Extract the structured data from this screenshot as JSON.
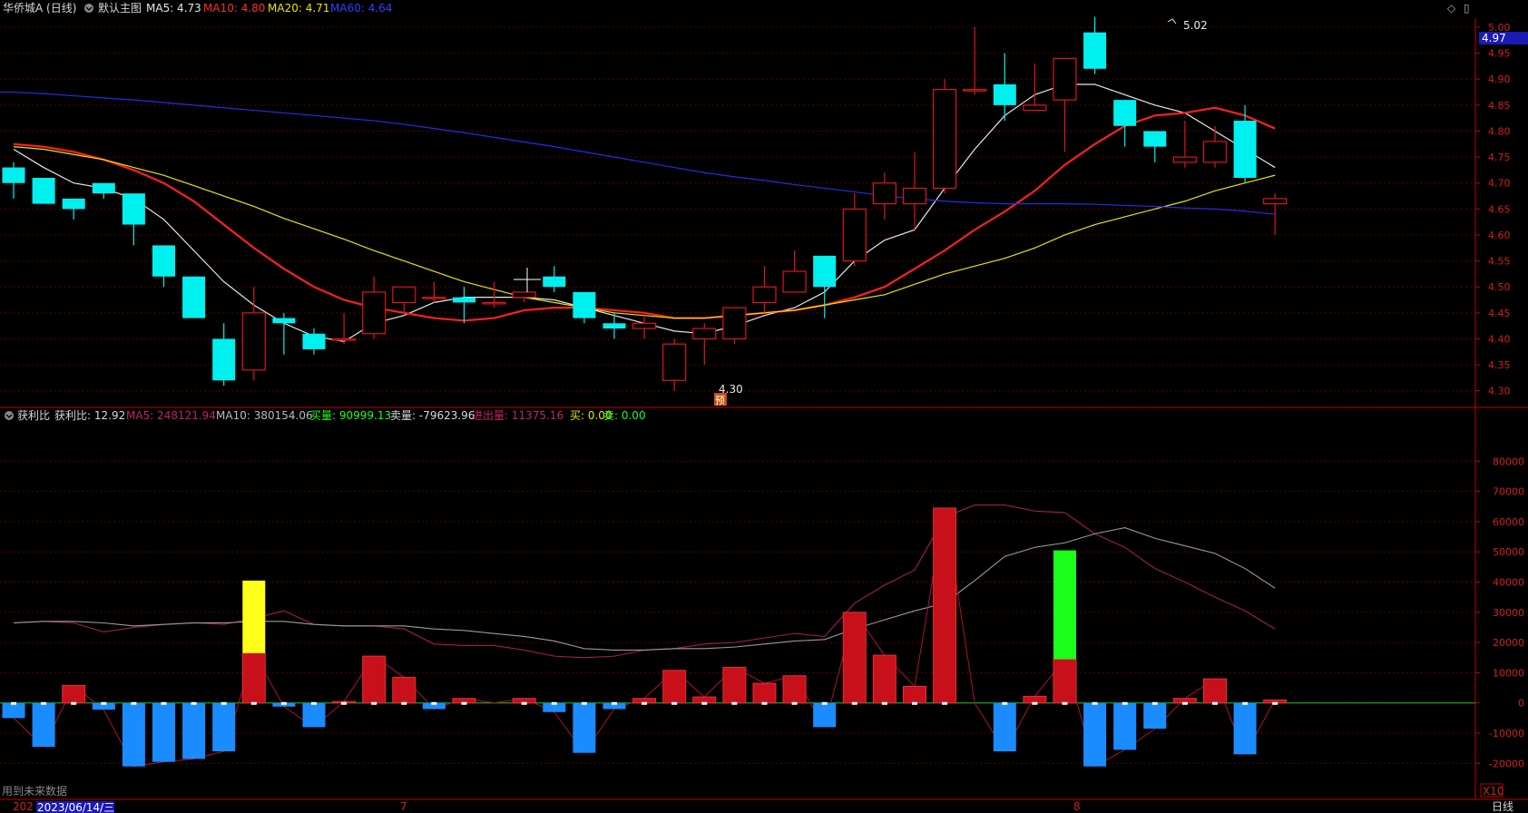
{
  "colors": {
    "up": "#e0151b",
    "down": "#00f0f0",
    "ma5": "#e8e8e8",
    "ma10": "#ff2020",
    "ma20": "#e6e600",
    "ma60": "#2a2ae8",
    "grid": "#5a0000",
    "axis": "#c00000",
    "tick": "#d02020",
    "bg": "#000000",
    "neg_bar": "#1a8cff",
    "zero": "#19c819",
    "yellow_bar": "#ffff1a",
    "green_bar": "#1aff1a"
  },
  "header": {
    "stock_name": "华侨城A (日线)",
    "template": "默认主图",
    "ma5": "MA5: 4.73",
    "ma10": "MA10: 4.80",
    "ma20": "MA20: 4.71",
    "ma60": "MA60: 4.64",
    "diamond_icon": "◇",
    "panel_icon": "▯"
  },
  "lower_header": {
    "name": "获利比",
    "ratio": "获利比: 12.92",
    "ma5": "MA5: 248121.94",
    "ma10": "MA10: 380154.06",
    "buy_vol": "买量: 90999.13",
    "sell_vol": "卖量: -79623.96",
    "in_out": "进出量: 11375.16",
    "buy": "买: 0.00",
    "sell": "卖: 0.00"
  },
  "footer": {
    "future_note": "用到未来数据",
    "year_stub": "202",
    "cursor_date": "2023/06/14/三",
    "month_7": "7",
    "month_8": "8",
    "scale": "X10",
    "period": "日线"
  },
  "chart_data": [
    {
      "type": "candlestick",
      "title": "华侨城A (日线)",
      "ylim": [
        4.27,
        5.02
      ],
      "y_ticks": [
        "5.00",
        "4.95",
        "4.90",
        "4.85",
        "4.80",
        "4.75",
        "4.70",
        "4.65",
        "4.60",
        "4.55",
        "4.50",
        "4.45",
        "4.40",
        "4.35",
        "4.30"
      ],
      "current_price": "4.97",
      "high_label": "5.02",
      "low_label": "4.30",
      "pre_label": "预",
      "candles": [
        [
          4.73,
          4.74,
          4.7,
          4.67
        ],
        [
          4.71,
          4.71,
          4.66,
          4.66
        ],
        [
          4.67,
          4.67,
          4.65,
          4.63
        ],
        [
          4.7,
          4.7,
          4.68,
          4.67
        ],
        [
          4.68,
          4.68,
          4.62,
          4.58
        ],
        [
          4.58,
          4.58,
          4.52,
          4.5
        ],
        [
          4.52,
          4.52,
          4.44,
          4.44
        ],
        [
          4.4,
          4.43,
          4.32,
          4.31
        ],
        [
          4.34,
          4.5,
          4.45,
          4.32
        ],
        [
          4.44,
          4.45,
          4.43,
          4.37
        ],
        [
          4.41,
          4.42,
          4.38,
          4.37
        ],
        [
          4.4,
          4.45,
          4.4,
          4.39
        ],
        [
          4.41,
          4.52,
          4.49,
          4.4
        ],
        [
          4.47,
          4.5,
          4.5,
          4.45
        ],
        [
          4.48,
          4.51,
          4.48,
          4.47
        ],
        [
          4.48,
          4.5,
          4.47,
          4.43
        ],
        [
          4.47,
          4.51,
          4.47,
          4.46
        ],
        [
          4.48,
          4.49,
          4.49,
          4.47
        ],
        [
          4.52,
          4.54,
          4.5,
          4.49
        ],
        [
          4.49,
          4.49,
          4.44,
          4.43
        ],
        [
          4.43,
          4.45,
          4.42,
          4.4
        ],
        [
          4.42,
          4.45,
          4.43,
          4.4
        ],
        [
          4.32,
          4.4,
          4.39,
          4.3
        ],
        [
          4.4,
          4.43,
          4.42,
          4.35
        ],
        [
          4.4,
          4.46,
          4.46,
          4.39
        ],
        [
          4.47,
          4.54,
          4.5,
          4.45
        ],
        [
          4.49,
          4.57,
          4.53,
          4.49
        ],
        [
          4.56,
          4.56,
          4.5,
          4.44
        ],
        [
          4.55,
          4.68,
          4.65,
          4.54
        ],
        [
          4.66,
          4.72,
          4.7,
          4.63
        ],
        [
          4.66,
          4.76,
          4.69,
          4.61
        ],
        [
          4.69,
          4.9,
          4.88,
          4.68
        ],
        [
          4.88,
          5.0,
          4.88,
          4.87
        ],
        [
          4.89,
          4.95,
          4.85,
          4.82
        ],
        [
          4.84,
          4.93,
          4.85,
          4.84
        ],
        [
          4.86,
          4.93,
          4.94,
          4.76
        ],
        [
          4.99,
          5.02,
          4.92,
          4.91
        ],
        [
          4.86,
          4.86,
          4.81,
          4.77
        ],
        [
          4.8,
          4.8,
          4.77,
          4.74
        ],
        [
          4.74,
          4.82,
          4.75,
          4.73
        ],
        [
          4.74,
          4.81,
          4.78,
          4.73
        ],
        [
          4.82,
          4.85,
          4.71,
          4.7
        ],
        [
          4.66,
          4.68,
          4.67,
          4.6
        ]
      ],
      "series": [
        {
          "name": "MA5",
          "values": [
            4.765,
            4.73,
            4.7,
            4.69,
            4.67,
            4.63,
            4.57,
            4.51,
            4.465,
            4.43,
            4.405,
            4.395,
            4.43,
            4.445,
            4.47,
            4.48,
            4.48,
            4.48,
            4.475,
            4.46,
            4.445,
            4.43,
            4.415,
            4.41,
            4.425,
            4.445,
            4.46,
            4.49,
            4.55,
            4.59,
            4.61,
            4.69,
            4.765,
            4.83,
            4.87,
            4.89,
            4.89,
            4.87,
            4.85,
            4.835,
            4.8,
            4.765,
            4.73
          ]
        },
        {
          "name": "MA10",
          "values": [
            4.775,
            4.77,
            4.76,
            4.745,
            4.725,
            4.7,
            4.665,
            4.62,
            4.575,
            4.535,
            4.5,
            4.475,
            4.46,
            4.45,
            4.44,
            4.435,
            4.44,
            4.455,
            4.46,
            4.46,
            4.455,
            4.45,
            4.44,
            4.44,
            4.445,
            4.45,
            4.455,
            4.465,
            4.48,
            4.5,
            4.535,
            4.57,
            4.61,
            4.645,
            4.685,
            4.735,
            4.775,
            4.81,
            4.83,
            4.835,
            4.845,
            4.83,
            4.805
          ]
        },
        {
          "name": "MA20",
          "values": [
            4.77,
            4.765,
            4.755,
            4.745,
            4.73,
            4.715,
            4.695,
            4.675,
            4.655,
            4.632,
            4.612,
            4.592,
            4.57,
            4.55,
            4.53,
            4.51,
            4.495,
            4.48,
            4.47,
            4.46,
            4.45,
            4.445,
            4.44,
            4.44,
            4.445,
            4.45,
            4.455,
            4.465,
            4.475,
            4.485,
            4.505,
            4.525,
            4.54,
            4.555,
            4.575,
            4.6,
            4.62,
            4.635,
            4.65,
            4.665,
            4.685,
            4.7,
            4.715
          ]
        },
        {
          "name": "MA60",
          "values": [
            4.875,
            4.872,
            4.868,
            4.864,
            4.86,
            4.855,
            4.85,
            4.845,
            4.84,
            4.835,
            4.83,
            4.825,
            4.82,
            4.813,
            4.805,
            4.797,
            4.788,
            4.779,
            4.77,
            4.76,
            4.75,
            4.74,
            4.73,
            4.72,
            4.712,
            4.705,
            4.697,
            4.69,
            4.683,
            4.675,
            4.67,
            4.665,
            4.662,
            4.66,
            4.66,
            4.66,
            4.659,
            4.657,
            4.655,
            4.652,
            4.65,
            4.646,
            4.64
          ]
        }
      ]
    },
    {
      "type": "bar",
      "title": "获利比",
      "ylim": [
        -25000,
        87000
      ],
      "y_ticks": [
        "80000",
        "70000",
        "60000",
        "50000",
        "40000",
        "30000",
        "20000",
        "10000",
        "0",
        "-10000",
        "-20000"
      ],
      "net_values": [
        -5000,
        -14500,
        5800,
        -2200,
        -21000,
        -19500,
        -18500,
        -16000,
        16500,
        -1200,
        -8000,
        500,
        15500,
        8500,
        -2000,
        1500,
        0,
        1500,
        -3000,
        -16500,
        -2000,
        1500,
        10800,
        2000,
        11800,
        6500,
        9000,
        -8000,
        30000,
        15800,
        5500,
        64500,
        0,
        -16000,
        2200,
        14500,
        -21000,
        -15500,
        -8500,
        1500,
        8000,
        -17000,
        1000
      ],
      "yellow_bar": {
        "index": 8,
        "from": 16500,
        "to": 40500
      },
      "green_bar": {
        "index": 35,
        "from": 14500,
        "to": 50500
      },
      "series": [
        {
          "name": "MA5",
          "values": [
            26500,
            27000,
            26500,
            23500,
            25000,
            26000,
            26500,
            26000,
            28000,
            30500,
            26000,
            25500,
            25500,
            24500,
            19500,
            19000,
            19000,
            17500,
            15500,
            15000,
            15500,
            17500,
            18000,
            19500,
            20000,
            21500,
            23000,
            22000,
            33000,
            39000,
            44000,
            61500,
            65500,
            65500,
            63500,
            63000,
            56000,
            51500,
            44500,
            40000,
            35000,
            30500,
            24500
          ]
        },
        {
          "name": "MA10",
          "values": [
            26500,
            27000,
            27000,
            26500,
            25500,
            26000,
            26500,
            26500,
            27000,
            27000,
            26000,
            25500,
            25500,
            25500,
            24500,
            24000,
            23000,
            22000,
            20500,
            18000,
            17500,
            17500,
            18000,
            18000,
            18500,
            19500,
            20500,
            21000,
            24500,
            27500,
            30500,
            33000,
            40500,
            48500,
            51500,
            53000,
            56000,
            58000,
            54500,
            52000,
            49500,
            44500,
            38000
          ]
        }
      ]
    }
  ]
}
